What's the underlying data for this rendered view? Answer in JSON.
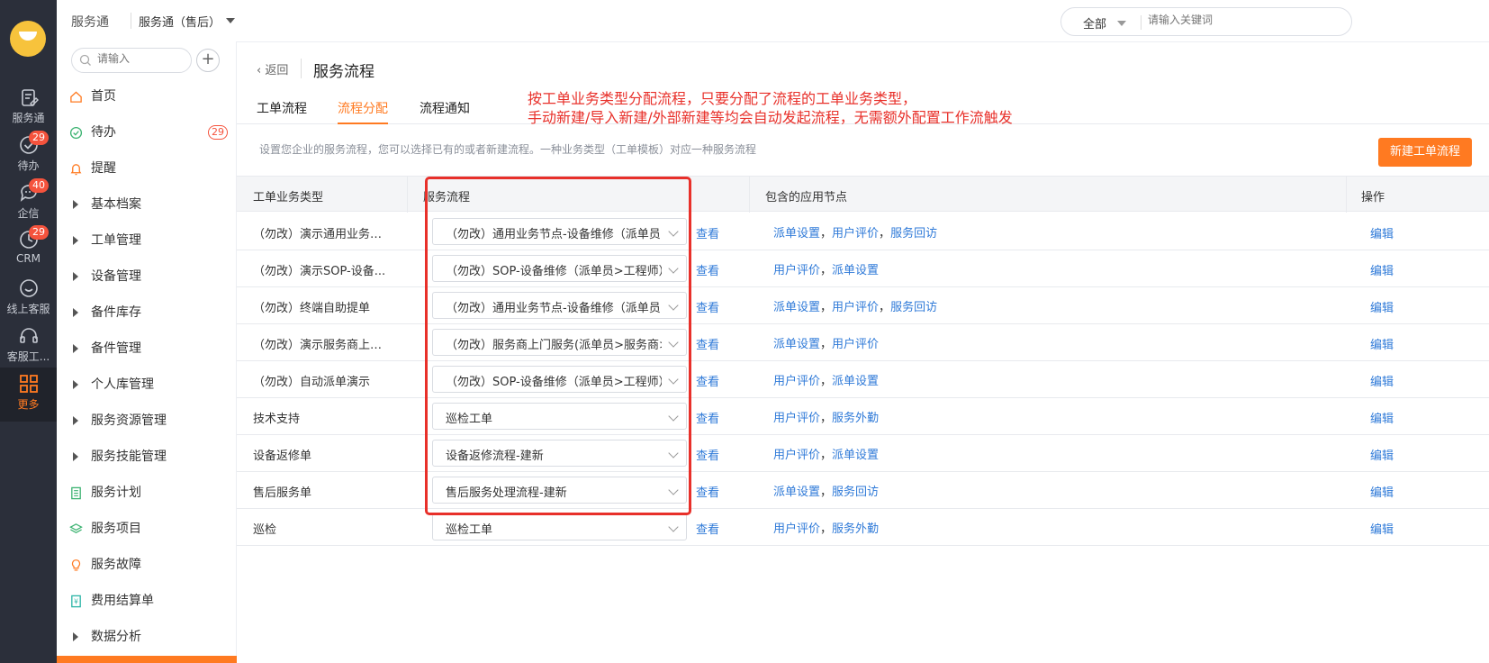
{
  "rail": {
    "items": [
      {
        "label": "服务通",
        "icon": "clipboard-edit-icon",
        "badge": ""
      },
      {
        "label": "待办",
        "icon": "check-circle-icon",
        "badge": "29"
      },
      {
        "label": "企信",
        "icon": "chat-bubble-icon",
        "badge": "40"
      },
      {
        "label": "CRM",
        "icon": "clock-icon",
        "badge": "29"
      },
      {
        "label": "线上客服",
        "icon": "smile-chat-icon",
        "badge": ""
      },
      {
        "label": "客服工...",
        "icon": "headset-icon",
        "badge": ""
      },
      {
        "label": "更多",
        "icon": "grid-icon",
        "badge": ""
      }
    ]
  },
  "topbar": {
    "app_name": "服务通",
    "switch_label": "服务通（售后）",
    "scope": "全部",
    "search_placeholder": "请输入关键词"
  },
  "sidebar": {
    "search_placeholder": "请输入",
    "add_label": "+",
    "items": [
      {
        "label": "首页",
        "icon": "home-icon",
        "badge": ""
      },
      {
        "label": "待办",
        "icon": "check-circle-icon",
        "badge": "29"
      },
      {
        "label": "提醒",
        "icon": "bell-icon",
        "badge": ""
      },
      {
        "label": "基本档案",
        "icon": "caret-right-icon",
        "badge": ""
      },
      {
        "label": "工单管理",
        "icon": "caret-right-icon",
        "badge": ""
      },
      {
        "label": "设备管理",
        "icon": "caret-right-icon",
        "badge": ""
      },
      {
        "label": "备件库存",
        "icon": "caret-right-icon",
        "badge": ""
      },
      {
        "label": "备件管理",
        "icon": "caret-right-icon",
        "badge": ""
      },
      {
        "label": "个人库管理",
        "icon": "caret-right-icon",
        "badge": ""
      },
      {
        "label": "服务资源管理",
        "icon": "caret-right-icon",
        "badge": ""
      },
      {
        "label": "服务技能管理",
        "icon": "caret-right-icon",
        "badge": ""
      },
      {
        "label": "服务计划",
        "icon": "document-list-icon",
        "badge": ""
      },
      {
        "label": "服务项目",
        "icon": "layers-icon",
        "badge": ""
      },
      {
        "label": "服务故障",
        "icon": "lightbulb-icon",
        "badge": ""
      },
      {
        "label": "费用结算单",
        "icon": "receipt-icon",
        "badge": ""
      },
      {
        "label": "数据分析",
        "icon": "caret-right-icon",
        "badge": ""
      }
    ]
  },
  "main": {
    "back_label": "返回",
    "page_title": "服务流程",
    "tabs": [
      {
        "label": "工单流程",
        "active": false
      },
      {
        "label": "流程分配",
        "active": true
      },
      {
        "label": "流程通知",
        "active": false
      }
    ],
    "annotation_line1": "按工单业务类型分配流程，只要分配了流程的工单业务类型，",
    "annotation_line2": "手动新建/导入新建/外部新建等均会自动发起流程，无需额外配置工作流触发",
    "description": "设置您企业的服务流程，您可以选择已有的或者新建流程。一种业务类型（工单模板）对应一种服务流程",
    "new_button": "新建工单流程"
  },
  "table": {
    "headers": {
      "type": "工单业务类型",
      "flow": "服务流程",
      "nodes": "包含的应用节点",
      "ops": "操作"
    },
    "view_label": "查看",
    "edit_label": "编辑",
    "rows": [
      {
        "type": "（勿改）演示通用业务节...",
        "flow": "（勿改）通用业务节点-设备维修（派单员>服务",
        "nodes": [
          "派单设置",
          "用户评价",
          "服务回访"
        ]
      },
      {
        "type": "（勿改）演示SOP-设备...",
        "flow": "（勿改）SOP-设备维修（派单员>工程师）接单",
        "nodes": [
          "用户评价",
          "派单设置"
        ]
      },
      {
        "type": "（勿改）终端自助提单",
        "flow": "（勿改）通用业务节点-设备维修（派单员>服务",
        "nodes": [
          "派单设置",
          "用户评价",
          "服务回访"
        ]
      },
      {
        "type": "（勿改）演示服务商上门...",
        "flow": "（勿改）服务商上门服务(派单员>服务商>服务",
        "nodes": [
          "派单设置",
          "用户评价"
        ]
      },
      {
        "type": "（勿改）自动派单演示",
        "flow": "（勿改）SOP-设备维修（派单员>工程师）接单",
        "nodes": [
          "用户评价",
          "派单设置"
        ]
      },
      {
        "type": "技术支持",
        "flow": "巡检工单",
        "nodes": [
          "用户评价",
          "服务外勤"
        ]
      },
      {
        "type": "设备返修单",
        "flow": "设备返修流程-建新",
        "nodes": [
          "用户评价",
          "派单设置"
        ]
      },
      {
        "type": "售后服务单",
        "flow": "售后服务处理流程-建新",
        "nodes": [
          "派单设置",
          "服务回访"
        ]
      },
      {
        "type": "巡检",
        "flow": "巡检工单",
        "nodes": [
          "用户评价",
          "服务外勤"
        ]
      }
    ]
  },
  "colors": {
    "accent": "#ff7a21",
    "link": "#2f7ad8",
    "annotation": "#e8302a",
    "rail_bg": "#2b2f3a"
  }
}
